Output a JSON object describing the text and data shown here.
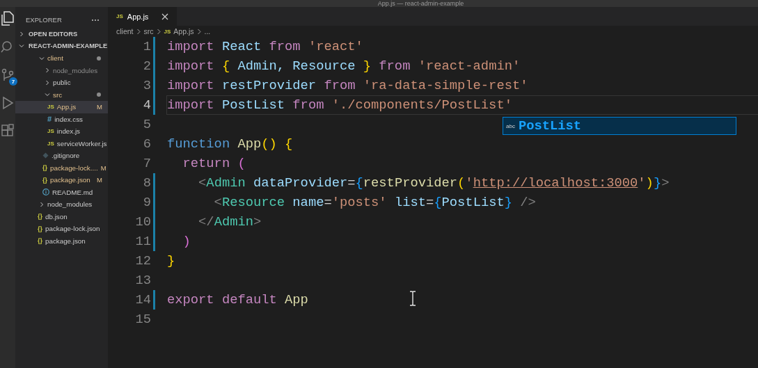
{
  "window": {
    "title": "App.js — react-admin-example"
  },
  "activity_bar": {
    "items": [
      {
        "kind": "files",
        "selected": true
      },
      {
        "kind": "search",
        "selected": false
      },
      {
        "kind": "source-control",
        "selected": false,
        "badge": "7"
      },
      {
        "kind": "run",
        "selected": false
      },
      {
        "kind": "extensions",
        "selected": false
      }
    ]
  },
  "sidebar": {
    "title": "EXPLORER",
    "sections": [
      {
        "label": "OPEN EDITORS",
        "expanded": false
      },
      {
        "label": "REACT-ADMIN-EXAMPLE",
        "expanded": true,
        "children": [
          {
            "name": "client",
            "kind": "folder",
            "expanded": true,
            "modified": true,
            "dimmed": false,
            "selected": false,
            "children": [
              {
                "name": "node_modules",
                "kind": "folder",
                "expanded": false,
                "modified": false,
                "dimmed": true,
                "selected": false
              },
              {
                "name": "public",
                "kind": "folder",
                "expanded": false,
                "modified": false,
                "dimmed": false,
                "selected": false
              },
              {
                "name": "src",
                "kind": "folder",
                "expanded": true,
                "modified": true,
                "dimmed": false,
                "selected": false,
                "children": [
                  {
                    "name": "App.js",
                    "kind": "js",
                    "glyph": "JS",
                    "modified": true,
                    "dimmed": false,
                    "badge": "M",
                    "selected": true
                  },
                  {
                    "name": "index.css",
                    "kind": "css",
                    "glyph": "#",
                    "modified": false,
                    "dimmed": false,
                    "selected": false
                  },
                  {
                    "name": "index.js",
                    "kind": "js",
                    "glyph": "JS",
                    "modified": false,
                    "dimmed": false,
                    "selected": false
                  },
                  {
                    "name": "serviceWorker.js",
                    "kind": "js",
                    "glyph": "JS",
                    "modified": false,
                    "dimmed": false,
                    "selected": false
                  }
                ]
              },
              {
                "name": ".gitignore",
                "kind": "git",
                "modified": false,
                "dimmed": false,
                "selected": false
              },
              {
                "name": "package-lock....",
                "kind": "json",
                "glyph": "{}",
                "modified": true,
                "dimmed": false,
                "badge": "M",
                "selected": false
              },
              {
                "name": "package.json",
                "kind": "json",
                "glyph": "{}",
                "modified": true,
                "dimmed": false,
                "badge": "M",
                "selected": false
              },
              {
                "name": "README.md",
                "kind": "info",
                "modified": false,
                "dimmed": false,
                "selected": false
              }
            ]
          },
          {
            "name": "node_modules",
            "kind": "folder",
            "expanded": false,
            "modified": false,
            "dimmed": false,
            "selected": false
          },
          {
            "name": "db.json",
            "kind": "json",
            "glyph": "{}",
            "modified": false,
            "dimmed": false,
            "selected": false
          },
          {
            "name": "package-lock.json",
            "kind": "json",
            "glyph": "{}",
            "modified": false,
            "dimmed": false,
            "selected": false
          },
          {
            "name": "package.json",
            "kind": "json",
            "glyph": "{}",
            "modified": false,
            "dimmed": false,
            "selected": false
          }
        ]
      }
    ]
  },
  "editor": {
    "tabs": [
      {
        "label": "App.js",
        "glyph": "JS",
        "selected": true
      }
    ],
    "breadcrumb": [
      {
        "label": "client"
      },
      {
        "label": "src"
      },
      {
        "label": "App.js",
        "glyph": "JS"
      },
      {
        "label": "..."
      }
    ],
    "lines": [
      {
        "number": "1",
        "modified": true,
        "current": false,
        "tokens": [
          {
            "text": "import",
            "kind": "keyword"
          },
          {
            "text": " React ",
            "kind": "variable"
          },
          {
            "text": "from",
            "kind": "keyword"
          },
          {
            "text": " 'react'",
            "kind": "string"
          }
        ]
      },
      {
        "number": "2",
        "modified": true,
        "current": false,
        "tokens": [
          {
            "text": "import",
            "kind": "keyword"
          },
          {
            "text": " {",
            "kind": "brace"
          },
          {
            "text": " Admin, Resource ",
            "kind": "variable"
          },
          {
            "text": "}",
            "kind": "brace"
          },
          {
            "text": " from",
            "kind": "keyword"
          },
          {
            "text": " 'react-admin'",
            "kind": "string"
          }
        ]
      },
      {
        "number": "3",
        "modified": true,
        "current": false,
        "tokens": [
          {
            "text": "import",
            "kind": "keyword"
          },
          {
            "text": " restProvider ",
            "kind": "variable"
          },
          {
            "text": "from",
            "kind": "keyword"
          },
          {
            "text": " 'ra-data-simple-rest'",
            "kind": "string"
          }
        ]
      },
      {
        "number": "4",
        "modified": true,
        "current": true,
        "tokens": [
          {
            "text": "import",
            "kind": "keyword"
          },
          {
            "text": " PostList ",
            "kind": "variable"
          },
          {
            "text": "from",
            "kind": "keyword"
          },
          {
            "text": " './components/PostList'",
            "kind": "string"
          }
        ]
      },
      {
        "number": "5",
        "modified": false,
        "current": false
      },
      {
        "number": "6",
        "modified": false,
        "current": false,
        "tokens": [
          {
            "text": "function",
            "kind": "declaration"
          },
          {
            "text": " App",
            "kind": "function"
          },
          {
            "text": "() {",
            "kind": "brace"
          }
        ]
      },
      {
        "number": "7",
        "modified": false,
        "current": false,
        "tokens": [
          {
            "text": "  return",
            "kind": "keyword"
          },
          {
            "text": " (",
            "kind": "paren"
          }
        ]
      },
      {
        "number": "8",
        "modified": true,
        "current": false,
        "tokens": [
          {
            "text": "    <",
            "kind": "punct"
          },
          {
            "text": "Admin",
            "kind": "tag"
          },
          {
            "text": " dataProvider",
            "kind": "variable"
          },
          {
            "text": "=",
            "kind": "plain"
          },
          {
            "text": "{",
            "kind": "bracket"
          },
          {
            "text": "restProvider",
            "kind": "function"
          },
          {
            "text": "(",
            "kind": "brace"
          },
          {
            "text": "'",
            "kind": "string"
          },
          {
            "text": "http://localhost:3000",
            "kind": "url"
          },
          {
            "text": "'",
            "kind": "string"
          },
          {
            "text": ")",
            "kind": "brace"
          },
          {
            "text": "}",
            "kind": "bracket"
          },
          {
            "text": ">",
            "kind": "punct"
          }
        ]
      },
      {
        "number": "9",
        "modified": true,
        "current": false,
        "tokens": [
          {
            "text": "      <",
            "kind": "punct"
          },
          {
            "text": "Resource",
            "kind": "tag"
          },
          {
            "text": " name",
            "kind": "variable"
          },
          {
            "text": "=",
            "kind": "plain"
          },
          {
            "text": "'posts'",
            "kind": "string"
          },
          {
            "text": " list",
            "kind": "variable"
          },
          {
            "text": "=",
            "kind": "plain"
          },
          {
            "text": "{",
            "kind": "bracket"
          },
          {
            "text": "PostList",
            "kind": "variable"
          },
          {
            "text": "}",
            "kind": "bracket"
          },
          {
            "text": " />",
            "kind": "punct"
          }
        ]
      },
      {
        "number": "10",
        "modified": true,
        "current": false,
        "tokens": [
          {
            "text": "    </",
            "kind": "punct"
          },
          {
            "text": "Admin",
            "kind": "tag"
          },
          {
            "text": ">",
            "kind": "punct"
          }
        ]
      },
      {
        "number": "11",
        "modified": true,
        "current": false,
        "tokens": [
          {
            "text": "  )",
            "kind": "paren"
          }
        ]
      },
      {
        "number": "12",
        "modified": false,
        "current": false,
        "tokens": [
          {
            "text": "}",
            "kind": "brace"
          }
        ]
      },
      {
        "number": "13",
        "modified": false,
        "current": false
      },
      {
        "number": "14",
        "modified": true,
        "current": false,
        "tokens": [
          {
            "text": "export default",
            "kind": "keyword"
          },
          {
            "text": " App",
            "kind": "function"
          }
        ]
      },
      {
        "number": "15",
        "modified": false,
        "current": false
      }
    ],
    "suggest": {
      "items": [
        {
          "kind": "text",
          "glyph": "abc",
          "label": "PostList",
          "selected": true
        }
      ]
    }
  }
}
